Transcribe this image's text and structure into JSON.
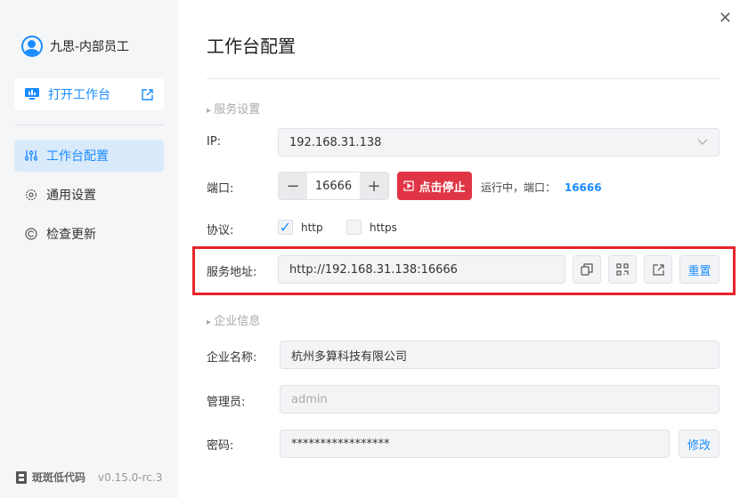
{
  "sidebar": {
    "user": "九思-内部员工",
    "open_workbench": "打开工作台",
    "items": [
      {
        "label": "工作台配置"
      },
      {
        "label": "通用设置"
      },
      {
        "label": "检查更新"
      }
    ],
    "brand": "斑斑低代码",
    "version": "v0.15.0-rc.3"
  },
  "main": {
    "title": "工作台配置",
    "service_section": "服务设置",
    "ip_label": "IP:",
    "ip_value": "192.168.31.138",
    "port_label": "端口:",
    "port_value": "16666",
    "stop_label": "点击停止",
    "status_text": "运行中，端口：",
    "status_port": "16666",
    "protocol_label": "协议:",
    "protocols": [
      {
        "label": "http",
        "checked": true
      },
      {
        "label": "https",
        "checked": false
      }
    ],
    "address_label": "服务地址:",
    "address_value": "http://192.168.31.138:16666",
    "reset_label": "重置",
    "company_section": "企业信息",
    "company_label": "企业名称:",
    "company_value": "杭州多算科技有限公司",
    "admin_label": "管理员:",
    "admin_placeholder": "admin",
    "password_label": "密码:",
    "password_value": "*****************",
    "modify_label": "修改"
  },
  "colors": {
    "accent": "#1a8cff",
    "danger": "#e03545",
    "highlight": "#e8232b"
  }
}
